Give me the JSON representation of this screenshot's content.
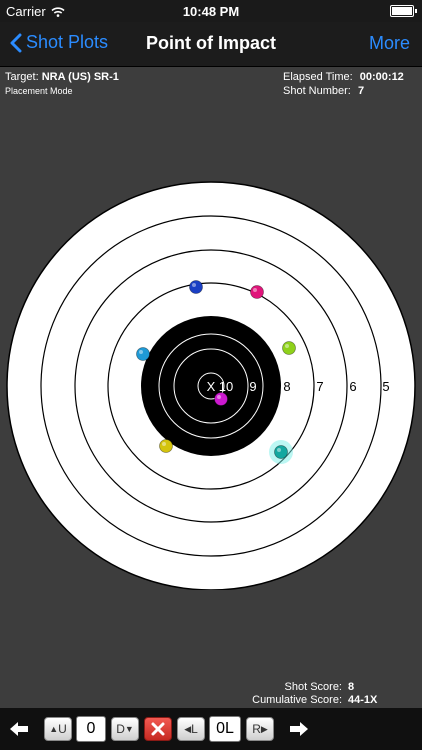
{
  "status": {
    "carrier": "Carrier",
    "time": "10:48 PM"
  },
  "nav": {
    "back_label": "Shot Plots",
    "title": "Point of Impact",
    "more_label": "More"
  },
  "info": {
    "target_label": "Target:",
    "target_value": "NRA (US) SR-1",
    "mode": "Placement Mode",
    "elapsed_label": "Elapsed Time:",
    "elapsed_value": "00:00:12",
    "shot_number_label": "Shot Number:",
    "shot_number_value": "7"
  },
  "target": {
    "ring_labels": [
      "X",
      "10",
      "9",
      "8",
      "7",
      "6",
      "5"
    ],
    "shots": [
      {
        "color": "#1a3fc4"
      },
      {
        "color": "#e0157a"
      },
      {
        "color": "#1f9ad6"
      },
      {
        "color": "#8fd11b"
      },
      {
        "color": "#d4c40e"
      },
      {
        "color": "#cc19cf"
      },
      {
        "color": "#14a8a0"
      }
    ]
  },
  "scores": {
    "shot_label": "Shot Score:",
    "shot_value": "8",
    "cumulative_label": "Cumulative Score:",
    "cumulative_value": "44-1X"
  },
  "toolbar": {
    "up_label": "U",
    "up_value": "0",
    "down_label": "D",
    "left_label": "L",
    "lr_value": "0L",
    "right_label": "R"
  },
  "colors": {
    "accent": "#2b8cff",
    "cancel": "#e0302a"
  }
}
